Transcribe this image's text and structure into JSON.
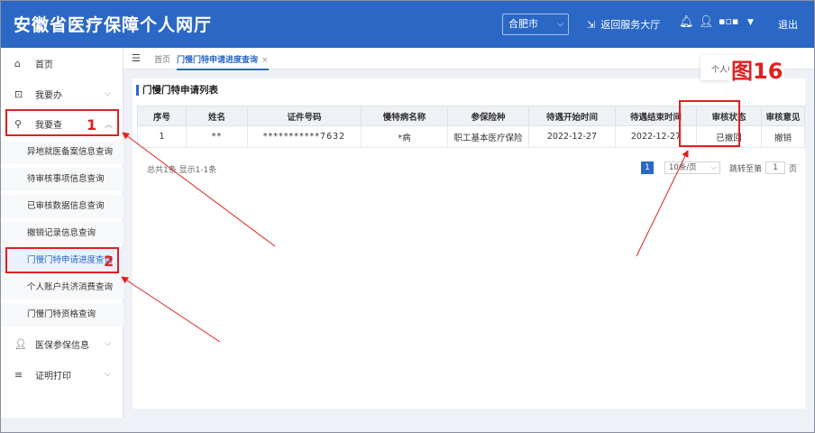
{
  "header": {
    "app_title": "安徽省医疗保障个人网厅",
    "city": "合肥市",
    "return_label": "返回服务大厅",
    "logout_label": "退出"
  },
  "sidebar": {
    "items": [
      {
        "label": "首页",
        "icon": "home-icon"
      },
      {
        "label": "我要办",
        "icon": "form-icon"
      },
      {
        "label": "我要查",
        "icon": "search-icon"
      },
      {
        "label": "医保参保信息",
        "icon": "user-icon"
      },
      {
        "label": "证明打印",
        "icon": "menu-icon"
      }
    ],
    "sub_items": [
      "异地就医备案信息查询",
      "待审核事项信息查询",
      "已审核数据信息查询",
      "撤销记录信息查询",
      "门慢门特申请进度查询",
      "个人账户共济消费查询",
      "门慢门特资格查询"
    ]
  },
  "tabs": {
    "home": "首页",
    "active": "门慢门特申请进度查询",
    "close": "×"
  },
  "tooltip": "个人中",
  "table": {
    "title": "门慢门特申请列表",
    "headers": [
      "序号",
      "姓名",
      "证件号码",
      "慢特病名称",
      "参保险种",
      "待遇开始时间",
      "待遇结束时间",
      "审核状态",
      "审核意见"
    ],
    "rows": [
      [
        "1",
        "**",
        "***********7632",
        "*病",
        "职工基本医疗保险",
        "2022-12-27",
        "2022-12-27",
        "已撤回",
        "撤销"
      ]
    ]
  },
  "pagination": {
    "total_text": "总共1条 显示1-1条",
    "current_page": "1",
    "page_size": "10条/页",
    "goto_label": "跳转至第",
    "goto_value": "1",
    "page_unit": "页"
  },
  "annotations": {
    "num1": "1",
    "num2": "2",
    "figure": "图16",
    "color": "#e02020"
  }
}
